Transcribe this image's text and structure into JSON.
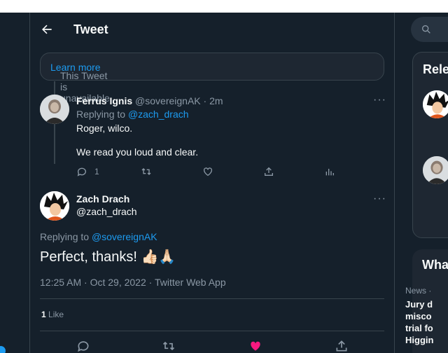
{
  "header": {
    "title": "Tweet"
  },
  "unavailable": {
    "text": "This Tweet is unavailable.",
    "link": "Learn more"
  },
  "reply_tweet": {
    "name": "Ferrus Ignis",
    "handle": "@sovereignAK",
    "time": "· 2m",
    "replying_label": "Replying to",
    "replying_to": "@zach_drach",
    "line1": "Roger, wilco.",
    "line2": "We read you loud and clear.",
    "reply_count": "1"
  },
  "main_tweet": {
    "name": "Zach Drach",
    "handle": "@zach_drach",
    "replying_label": "Replying to",
    "replying_to": "@sovereignAK",
    "text": "Perfect, thanks! 👍🏻🙏🏻",
    "meta": "12:25 AM · Oct 29, 2022 · Twitter Web App",
    "like_count": "1",
    "like_label": "Like"
  },
  "sidebar": {
    "relevant_title": "Rele",
    "whats_title": "Wha",
    "news_label": "News ·",
    "news_title": "Jury d\nmisco\ntrial fo\nHiggin"
  },
  "colors": {
    "background": "#15202b",
    "accent": "#1d9bf0",
    "like": "#f91880",
    "muted": "#8b98a5"
  }
}
